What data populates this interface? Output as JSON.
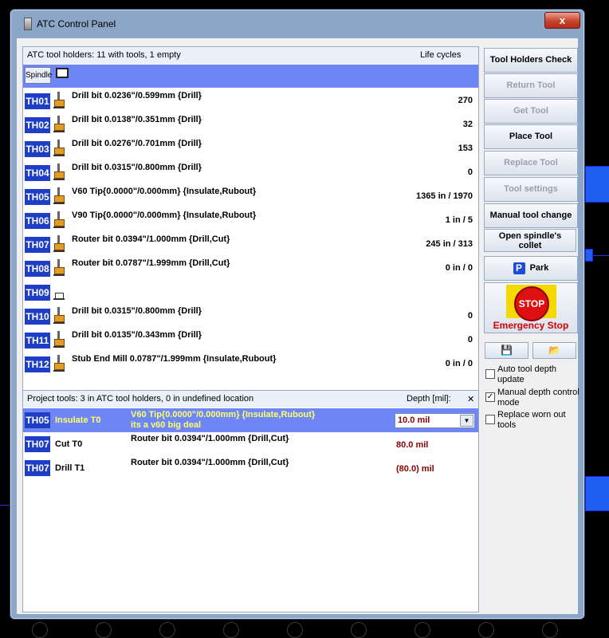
{
  "window": {
    "title": "ATC Control Panel",
    "close_glyph": "x"
  },
  "holders_panel": {
    "header_left": "ATC tool holders: 11 with tools, 1 empty",
    "header_right": "Life cycles",
    "spindle_label": "Spindle",
    "rows": [
      {
        "id": "TH01",
        "desc": "Drill bit 0.0236\"/0.599mm {Drill}",
        "life": "270"
      },
      {
        "id": "TH02",
        "desc": "Drill bit 0.0138\"/0.351mm {Drill}",
        "life": "32"
      },
      {
        "id": "TH03",
        "desc": "Drill bit 0.0276\"/0.701mm {Drill}",
        "life": "153"
      },
      {
        "id": "TH04",
        "desc": "Drill bit 0.0315\"/0.800mm {Drill}",
        "life": "0"
      },
      {
        "id": "TH05",
        "desc": "V60  Tip{0.0000\"/0.000mm} {Insulate,Rubout}",
        "life": "1365 in / 1970"
      },
      {
        "id": "TH06",
        "desc": "V90  Tip{0.0000\"/0.000mm} {Insulate,Rubout}",
        "life": "1 in / 5"
      },
      {
        "id": "TH07",
        "desc": "Router bit 0.0394\"/1.000mm {Drill,Cut}",
        "life": "245 in / 313"
      },
      {
        "id": "TH08",
        "desc": "Router bit 0.0787\"/1.999mm {Drill,Cut}",
        "life": "0 in / 0"
      },
      {
        "id": "TH09",
        "desc": "",
        "life": ""
      },
      {
        "id": "TH10",
        "desc": "Drill bit 0.0315\"/0.800mm {Drill}",
        "life": "0"
      },
      {
        "id": "TH11",
        "desc": "Drill bit 0.0135\"/0.343mm {Drill}",
        "life": "0"
      },
      {
        "id": "TH12",
        "desc": "Stub End Mill 0.0787\"/1.999mm {Insulate,Rubout}",
        "life": "0 in / 0"
      }
    ]
  },
  "project_panel": {
    "header_left": "Project tools: 3 in ATC tool holders, 0 in undefined location",
    "header_right": "Depth [mil]:",
    "close_glyph": "✕",
    "rows": [
      {
        "id": "TH05",
        "name": "Insulate T0",
        "desc": "V60  Tip{0.0000\"/0.000mm} {Insulate,Rubout}",
        "note": "its a v60 big deal",
        "depth": "10.0 mil"
      },
      {
        "id": "TH07",
        "name": "Cut T0",
        "desc": "Router bit 0.0394\"/1.000mm {Drill,Cut}",
        "note": "",
        "depth": "80.0 mil"
      },
      {
        "id": "TH07",
        "name": "Drill T1",
        "desc": "Router bit 0.0394\"/1.000mm {Drill,Cut}",
        "note": "",
        "depth": "(80.0) mil"
      }
    ]
  },
  "side": {
    "tool_holders_check": "Tool Holders Check",
    "return_tool": "Return Tool",
    "get_tool": "Get Tool",
    "place_tool": "Place Tool",
    "replace_tool": "Replace Tool",
    "tool_settings": "Tool settings",
    "manual_tool_change": "Manual tool change",
    "open_collet_1": "Open spindle's",
    "open_collet_2": "collet",
    "park_glyph": "P",
    "park": "Park",
    "stop": "STOP",
    "emergency_stop": "Emergency Stop",
    "checks": [
      {
        "label": "Auto tool depth update",
        "checked": false
      },
      {
        "label": "Manual depth control mode",
        "checked": true
      },
      {
        "label": "Replace worn out tools",
        "checked": false
      }
    ]
  },
  "colors": {
    "accent": "#6f86f7",
    "badge": "#1e3ec7",
    "danger": "#dd0000",
    "depth": "#8b0000"
  }
}
